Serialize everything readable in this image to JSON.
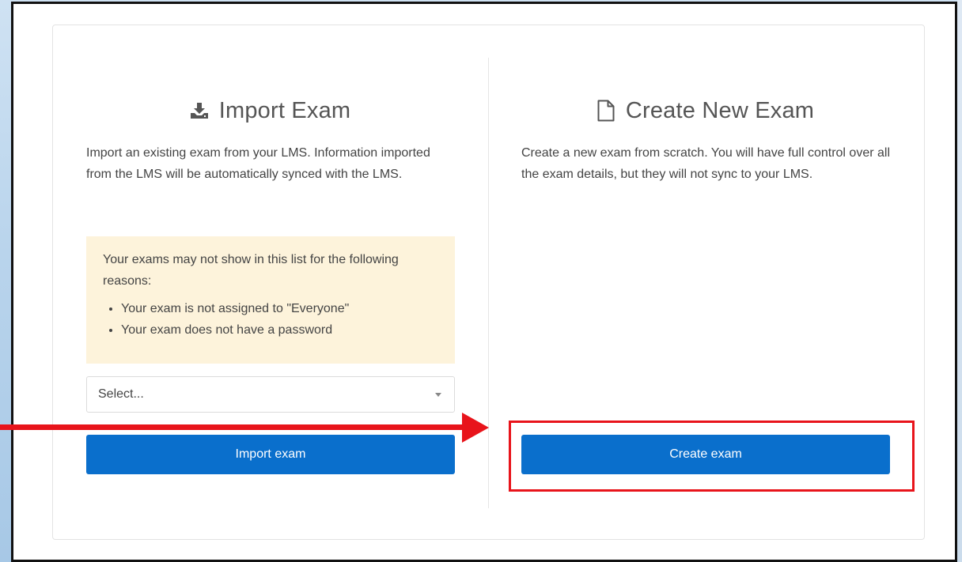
{
  "import_panel": {
    "title": "Import Exam",
    "icon": "download-icon",
    "description": "Import an existing exam from your LMS. Information imported from the LMS will be automatically synced with the LMS.",
    "notice": {
      "intro": "Your exams may not show in this list for the following reasons:",
      "reasons": [
        "Your exam is not assigned to \"Everyone\"",
        "Your exam does not have a password"
      ],
      "background": "#fdf3db"
    },
    "select": {
      "placeholder": "Select..."
    },
    "button_label": "Import exam"
  },
  "create_panel": {
    "title": "Create New Exam",
    "icon": "file-icon",
    "description": "Create a new exam from scratch. You will have full control over all the exam details, but they will not sync to your LMS.",
    "button_label": "Create exam"
  },
  "colors": {
    "button": "#0a6fcc",
    "annotation": "#e8141b"
  }
}
